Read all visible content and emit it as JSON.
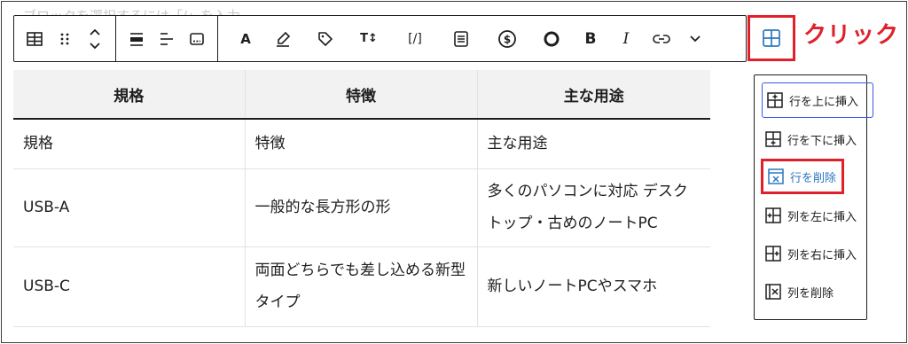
{
  "hint_text": "ブロックを選択するには「/」を入力",
  "toolbar": {
    "groups": [
      [
        "table-icon",
        "drag-handle-icon",
        "move-up-down-icon"
      ],
      [
        "align-full-icon",
        "align-left-icon",
        "align-center-icon"
      ],
      [
        "text-color-icon",
        "highlight-icon",
        "tag-icon",
        "font-size-icon",
        "inline-code-icon",
        "paragraph-icon",
        "dollar-icon",
        "circle-icon",
        "bold-icon",
        "italic-icon",
        "link-icon",
        "chevron-down-icon"
      ]
    ],
    "bold_label": "B",
    "italic_label": "I",
    "text_a_label": "A",
    "font_size_label": "T↕",
    "code_label": "[/]"
  },
  "annotation": {
    "click_label": "クリック",
    "accent_color": "#e0202a"
  },
  "table": {
    "headers": [
      "規格",
      "特徴",
      "主な用途"
    ],
    "rows": [
      [
        "規格",
        "特徴",
        "主な用途"
      ],
      [
        "USB-A",
        "一般的な長方形の形",
        "多くのパソコンに対応 デスクトップ・古めのノートPC"
      ],
      [
        "USB-C",
        "両面どちらでも差し込める新型タイプ",
        "新しいノートPCやスマホ"
      ]
    ]
  },
  "menu": {
    "items": [
      {
        "label": "行を上に挿入",
        "icon": "insert-row-before-icon"
      },
      {
        "label": "行を下に挿入",
        "icon": "insert-row-after-icon"
      },
      {
        "label": "行を削除",
        "icon": "delete-row-icon"
      },
      {
        "label": "列を左に挿入",
        "icon": "insert-column-before-icon"
      },
      {
        "label": "列を右に挿入",
        "icon": "insert-column-after-icon"
      },
      {
        "label": "列を削除",
        "icon": "delete-column-icon"
      }
    ]
  }
}
